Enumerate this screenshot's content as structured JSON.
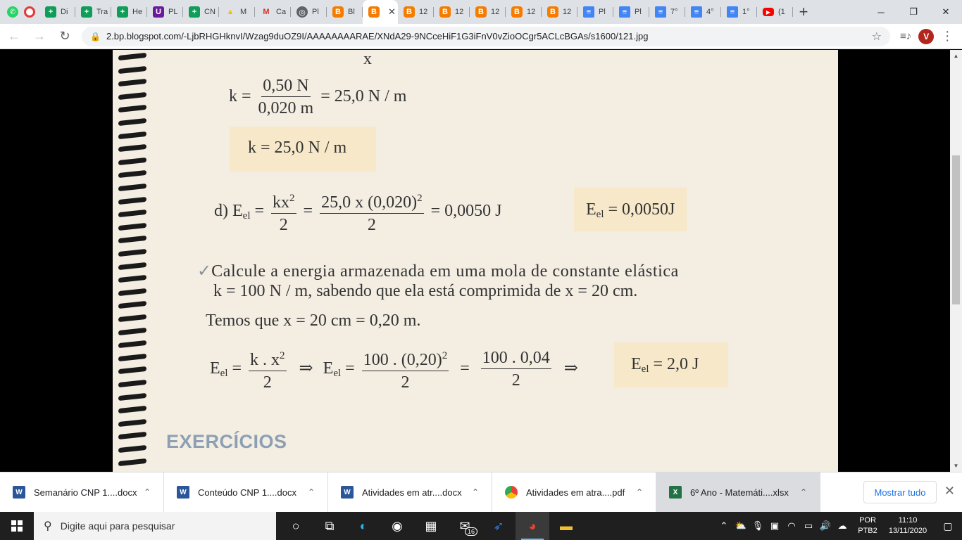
{
  "browser": {
    "tabs": [
      {
        "icon": "sheets",
        "label": "Di"
      },
      {
        "icon": "sheets",
        "label": "Tra"
      },
      {
        "icon": "sheets",
        "label": "He"
      },
      {
        "icon": "purple",
        "label": "PL"
      },
      {
        "icon": "sheets",
        "label": "CN"
      },
      {
        "icon": "drive",
        "label": "M"
      },
      {
        "icon": "gmail",
        "label": "Ca"
      },
      {
        "icon": "globe",
        "label": "Pl"
      },
      {
        "icon": "blogger",
        "label": "Bl"
      },
      {
        "icon": "blogger",
        "label": ""
      },
      {
        "icon": "blogger",
        "label": "12"
      },
      {
        "icon": "blogger",
        "label": "12"
      },
      {
        "icon": "blogger",
        "label": "12"
      },
      {
        "icon": "blogger",
        "label": "12"
      },
      {
        "icon": "blogger",
        "label": "12"
      },
      {
        "icon": "docs",
        "label": "Pl"
      },
      {
        "icon": "docs",
        "label": "Pl"
      },
      {
        "icon": "docs",
        "label": "7°"
      },
      {
        "icon": "docs",
        "label": "4°"
      },
      {
        "icon": "docs",
        "label": "1°"
      },
      {
        "icon": "yt",
        "label": "(1"
      }
    ],
    "active_tab_index": 9,
    "url": "2.bp.blogspot.com/-LjbRHGHknvI/Wzag9duOZ9I/AAAAAAAARAE/XNdA29-9NCceHiF1G3iFnV0vZioOCgr5ACLcBGAs/s1600/121.jpg",
    "profile_initial": "V"
  },
  "document": {
    "top_partial": "x",
    "k_eq": {
      "lhs": "k =",
      "num": "0,50 N",
      "den": "0,020 m",
      "rhs": "= 25,0 N / m"
    },
    "k_result": "k = 25,0 N / m",
    "d_line": {
      "label": "d) E",
      "sub": "el",
      "eq": "=",
      "f1_num": "kx",
      "f1_num_sup": "2",
      "f1_den": "2",
      "eq2": "=",
      "f2_num": "25,0 x (0,020)",
      "f2_num_sup": "2",
      "f2_den": "2",
      "rhs": "= 0,0050 J"
    },
    "d_result": {
      "lhs": "E",
      "sub": "el",
      "rhs": "= 0,0050J"
    },
    "question_check": "✓",
    "question_line1": "Calcule a energia armazenada em uma mola de constante elástica",
    "question_line2": "k = 100 N / m, sabendo que ela está comprimida de x = 20 cm.",
    "given": "Temos que x = 20 cm = 0,20 m.",
    "e_line": {
      "lhs": "E",
      "sub": "el",
      "eq": "=",
      "f1_num": "k . x",
      "f1_num_sup": "2",
      "f1_den": "2",
      "arrow1": "⇒",
      "lhs2": "E",
      "sub2": "el",
      "eq2": "=",
      "f2_num": "100 . (0,20)",
      "f2_num_sup": "2",
      "f2_den": "2",
      "eq3": "=",
      "f3_num": "100 . 0,04",
      "f3_den": "2",
      "arrow2": "⇒"
    },
    "e_result": {
      "lhs": "E",
      "sub": "el",
      "rhs": "= 2,0 J"
    },
    "heading": "EXERCÍCIOS"
  },
  "downloads": [
    {
      "icon": "word",
      "name": "Semanário CNP 1....docx"
    },
    {
      "icon": "word",
      "name": "Conteúdo CNP 1....docx"
    },
    {
      "icon": "word",
      "name": "Atividades em atr....docx"
    },
    {
      "icon": "chrome",
      "name": "Atividades em atra....pdf"
    },
    {
      "icon": "excel",
      "name": "6º Ano - Matemáti....xlsx"
    }
  ],
  "show_all_label": "Mostrar tudo",
  "taskbar": {
    "search_placeholder": "Digite aqui para pesquisar",
    "mail_badge": "16",
    "lang_line1": "POR",
    "lang_line2": "PTB2",
    "time": "11:10",
    "date": "13/11/2020"
  }
}
